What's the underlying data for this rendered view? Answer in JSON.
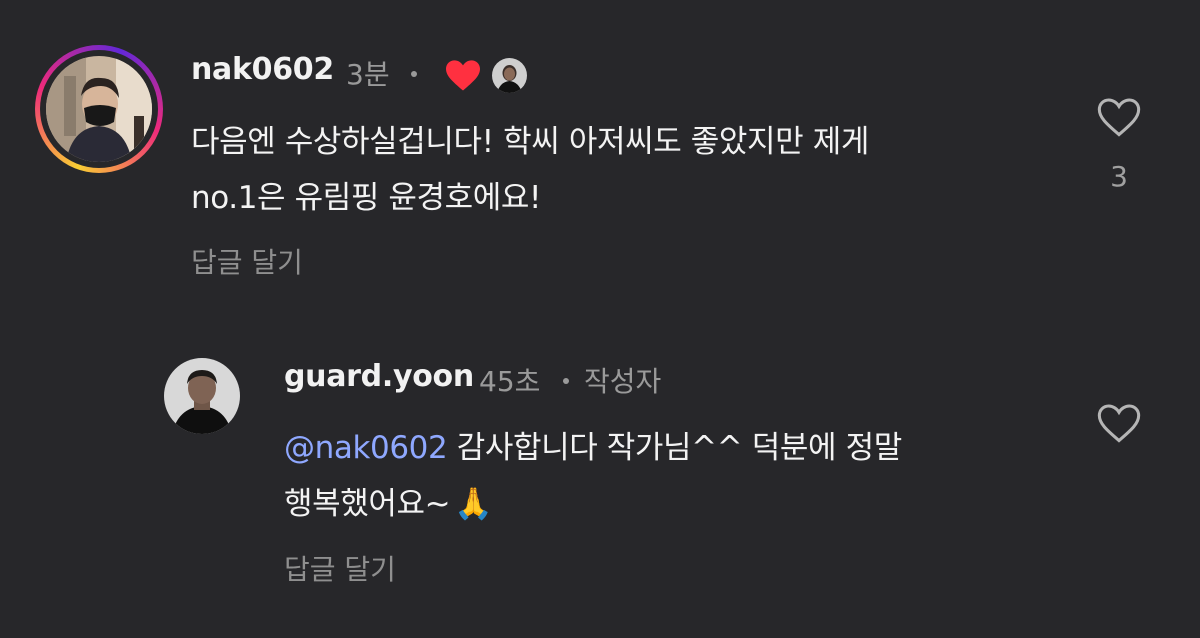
{
  "comment": {
    "username": "nak0602",
    "time": "3분",
    "body_line1": "다음엔 수상하실겁니다! 학씨 아저씨도 좋았지만 제게",
    "body_line2": "no.1은 유림핑 윤경호에요!",
    "reply_label": "답글 달기",
    "like_count": "3",
    "liked_by_author": true,
    "colors": {
      "heart": "#ff3040",
      "ring_start": "#f9ce34",
      "ring_mid": "#ee2a7b"
    }
  },
  "reply": {
    "username": "guard.yoon",
    "time": "45초",
    "author_badge": "작성자",
    "mention": "@nak0602",
    "body_line1_rest": " 감사합니다 작가님^^ 덕분에 정말",
    "body_line2": "행복했어요~",
    "emoji": "🙏",
    "reply_label": "답글 달기",
    "colors": {
      "mention": "#8fa8ff"
    }
  },
  "icons": {
    "like": "heart-outline-icon",
    "author_liked": "heart-filled-icon",
    "folded_hands": "folded-hands-emoji"
  }
}
